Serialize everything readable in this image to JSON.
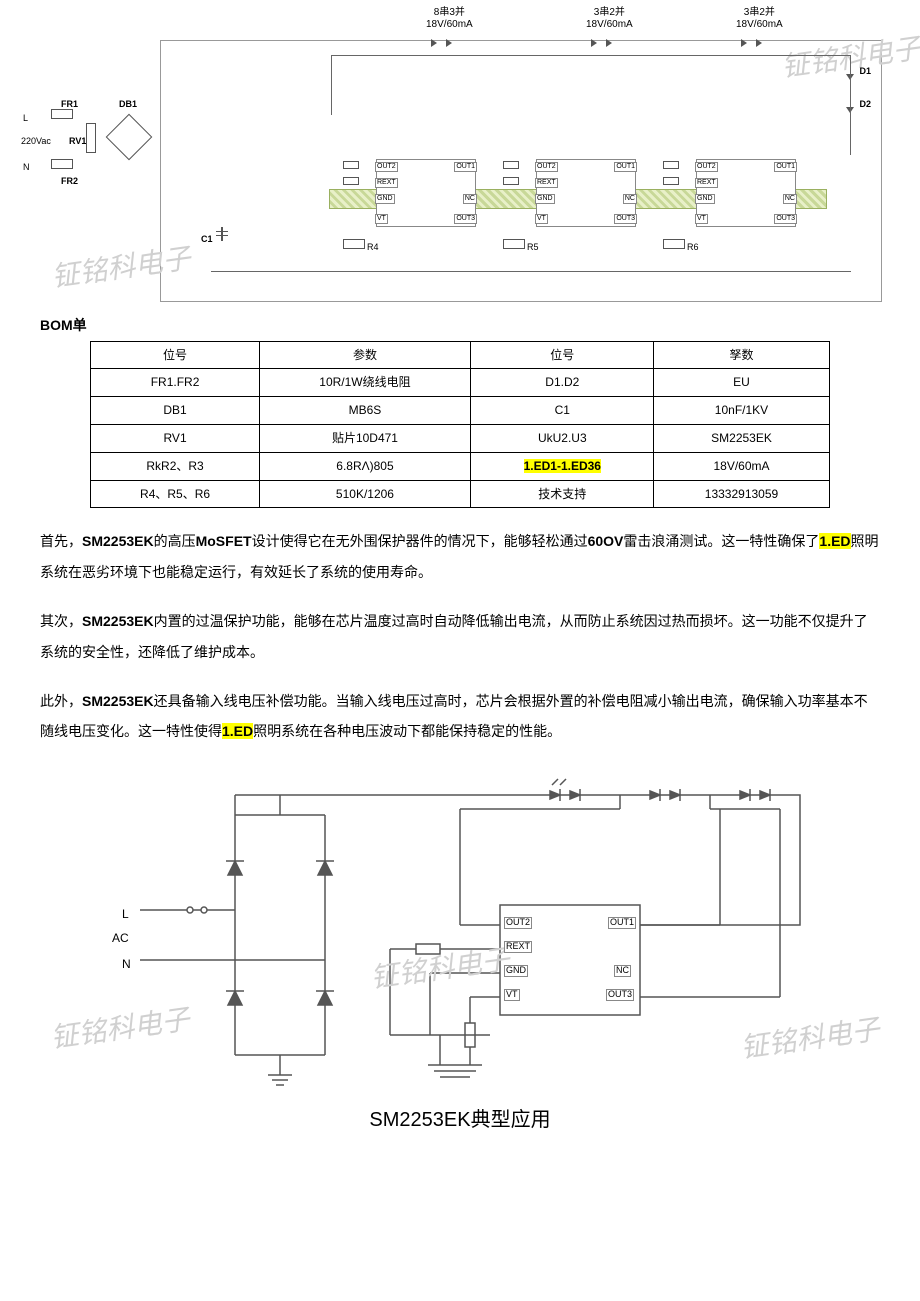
{
  "schematic1": {
    "strip1_line1": "8串3并",
    "strip1_line2": "18V/60mA",
    "strip2_line1": "3串2并",
    "strip2_line2": "18V/60mA",
    "strip3_line1": "3串2并",
    "strip3_line2": "18V/60mA",
    "FR1": "FR1",
    "DB1": "DB1",
    "L": "L",
    "N": "N",
    "ac": "220Vac",
    "RV1": "RV1",
    "FR2": "FR2",
    "C1": "C1",
    "D1": "D1",
    "D2": "D2",
    "R4": "R4",
    "R5": "R5",
    "R6": "R6",
    "pins": {
      "OUT1": "OUT1",
      "OUT2": "OUT2",
      "OUT3": "OUT3",
      "REXT": "REXT",
      "GND": "GND",
      "VT": "VT",
      "NC": "NC"
    },
    "watermark": "钲铭科电子"
  },
  "bom": {
    "heading": "BOM单",
    "headers": [
      "位号",
      "参数",
      "位号",
      "孥数"
    ],
    "rows": [
      [
        "FR1.FR2",
        "10R/1W绕线电阻",
        "D1.D2",
        "EU"
      ],
      [
        "DB1",
        "MB6S",
        "C1",
        "10nF/1KV"
      ],
      [
        "RV1",
        "贴片10D471",
        "UkU2.U3",
        "SM2253EK"
      ],
      [
        "RkR2、R3",
        "6.8RΛ)805",
        "1.ED1-1.ED36",
        "18V/60mA"
      ],
      [
        "R4、R5、R6",
        "510K/1206",
        "技术支持",
        "13332913059"
      ]
    ]
  },
  "para1": {
    "t1": "首先，",
    "b1": "SM2253EK",
    "t2": "的高压",
    "b2": "MoSFET",
    "t3": "设计使得它在无外围保护器件的情况下，能够轻松通过",
    "b3": "60OV",
    "t4": "雷击浪涌测试。这一特性确保了",
    "hl1": "1.ED",
    "t5": "照明系统在恶劣环境下也能稳定运行，有效延长了系统的使用寿命。"
  },
  "para2": {
    "t1": "其次，",
    "b1": "SM2253EK",
    "t2": "内置的过温保护功能，能够在芯片温度过高时自动降低输出电流，从而防止系统因过热而损坏。这一功能不仅提升了系统的安全性，还降低了维护成本。"
  },
  "para3": {
    "t1": "此外，",
    "b1": "SM2253EK",
    "t2": "还具备输入线电压补偿功能。当输入线电压过高时，芯片会根据外置的补偿电阻减小输出电流，确保输入功率基本不随线电压变化。这一特性使得",
    "hl1": "1.ED",
    "t3": "照明系统在各种电压波动下都能保持稳定的性能。"
  },
  "schematic2": {
    "L": "L",
    "AC": "AC",
    "N": "N",
    "pins": {
      "OUT1": "OUT1",
      "OUT2": "OUT2",
      "OUT3": "OUT3",
      "REXT": "REXT",
      "GND": "GND",
      "VT": "VT",
      "NC": "NC"
    },
    "caption": "SM2253EK典型应用",
    "watermark": "钲铭科电子"
  }
}
